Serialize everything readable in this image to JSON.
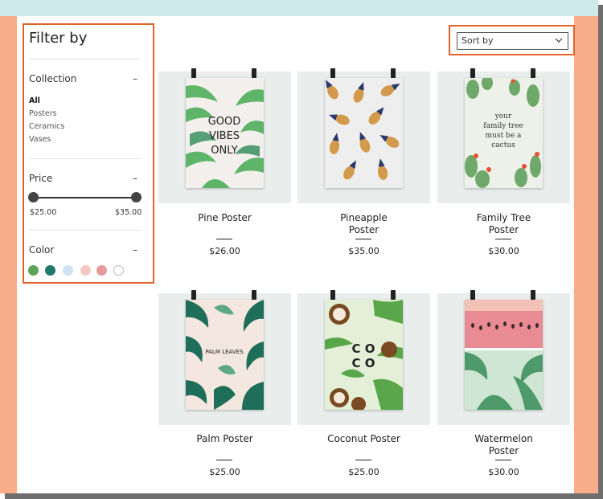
{
  "filter": {
    "title": "Filter by",
    "collection": {
      "title": "Collection",
      "toggle": "–",
      "items": [
        "All",
        "Posters",
        "Ceramics",
        "Vases"
      ]
    },
    "price": {
      "title": "Price",
      "toggle": "–",
      "min_label": "$25.00",
      "max_label": "$35.00"
    },
    "color": {
      "title": "Color",
      "toggle": "–",
      "swatches": [
        "#5fa35a",
        "#1f7a6a",
        "#cfe2f1",
        "#f3c9c2",
        "#e49a9a",
        "#ffffff"
      ]
    }
  },
  "sort": {
    "label": "Sort by"
  },
  "products": [
    {
      "name": "Pine Poster",
      "price": "$26.00",
      "art": "good-vibes"
    },
    {
      "name": "Pineapple Poster",
      "price": "$35.00",
      "art": "pineapples"
    },
    {
      "name": "Family Tree Poster",
      "price": "$30.00",
      "art": "cactus"
    },
    {
      "name": "Palm Poster",
      "price": "$25.00",
      "art": "palm-leaves"
    },
    {
      "name": "Coconut Poster",
      "price": "$25.00",
      "art": "coco"
    },
    {
      "name": "Watermelon Poster",
      "price": "$30.00",
      "art": "watermelon"
    }
  ],
  "poster_text": {
    "good_vibes": [
      "GOOD",
      "VIBES",
      "ONLY"
    ],
    "family_tree": [
      "your",
      "family tree",
      "must be a",
      "cactus"
    ],
    "palm_leaves": [
      "PALM LEAVES"
    ],
    "coco": [
      "C O",
      "C O"
    ]
  }
}
